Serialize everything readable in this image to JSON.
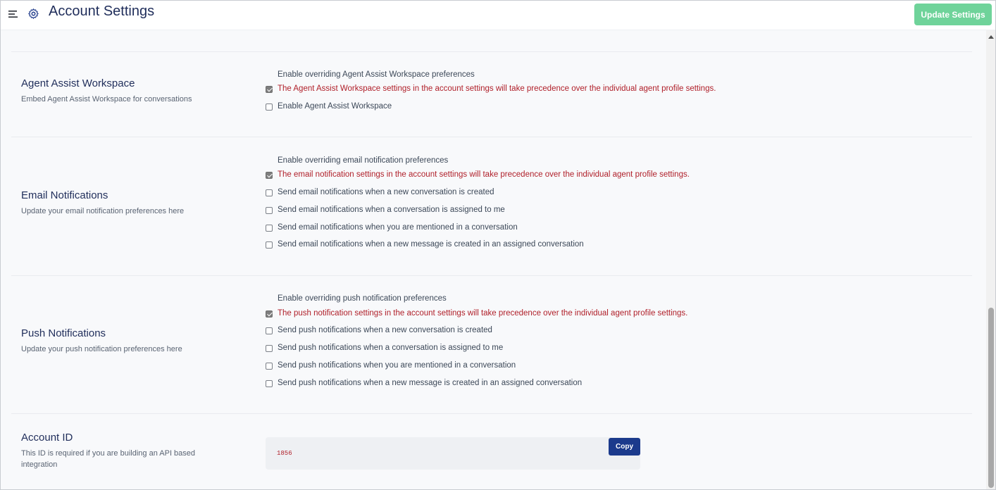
{
  "header": {
    "menu_icon": "hamburger-menu-icon",
    "gear_icon": "gear-icon",
    "title": "Account Settings",
    "update_button": "Update Settings",
    "update_button_color": "#6fd39a"
  },
  "sections": {
    "agent_assist": {
      "title": "Agent Assist Workspace",
      "description": "Embed Agent Assist Workspace for conversations",
      "override_heading": "Enable overriding Agent Assist Workspace preferences",
      "override_option": {
        "label": "The Agent Assist Workspace settings in the account settings will take precedence over the individual agent profile settings.",
        "checked": true
      },
      "options": [
        {
          "label": "Enable Agent Assist Workspace",
          "checked": false
        }
      ]
    },
    "email": {
      "title": "Email Notifications",
      "description": "Update your email notification preferences here",
      "override_heading": "Enable overriding email notification preferences",
      "override_option": {
        "label": "The email notification settings in the account settings will take precedence over the individual agent profile settings.",
        "checked": true
      },
      "options": [
        {
          "label": "Send email notifications when a new conversation is created",
          "checked": false
        },
        {
          "label": "Send email notifications when a conversation is assigned to me",
          "checked": false
        },
        {
          "label": "Send email notifications when you are mentioned in a conversation",
          "checked": false
        },
        {
          "label": "Send email notifications when a new message is created in an assigned conversation",
          "checked": false
        }
      ]
    },
    "push": {
      "title": "Push Notifications",
      "description": "Update your push notification preferences here",
      "override_heading": "Enable overriding push notification preferences",
      "override_option": {
        "label": "The push notification settings in the account settings will take precedence over the individual agent profile settings.",
        "checked": true
      },
      "options": [
        {
          "label": "Send push notifications when a new conversation is created",
          "checked": false
        },
        {
          "label": "Send push notifications when a conversation is assigned to me",
          "checked": false
        },
        {
          "label": "Send push notifications when you are mentioned in a conversation",
          "checked": false
        },
        {
          "label": "Send push notifications when a new message is created in an assigned conversation",
          "checked": false
        }
      ]
    },
    "account_id": {
      "title": "Account ID",
      "description": "This ID is required if you are building an API based integration",
      "value": "1856",
      "copy_button": "Copy"
    }
  },
  "colors": {
    "title": "#1f2d5a",
    "warning": "#b0202a",
    "copy_button": "#1b3a8c",
    "background": "#f8f9fb"
  }
}
